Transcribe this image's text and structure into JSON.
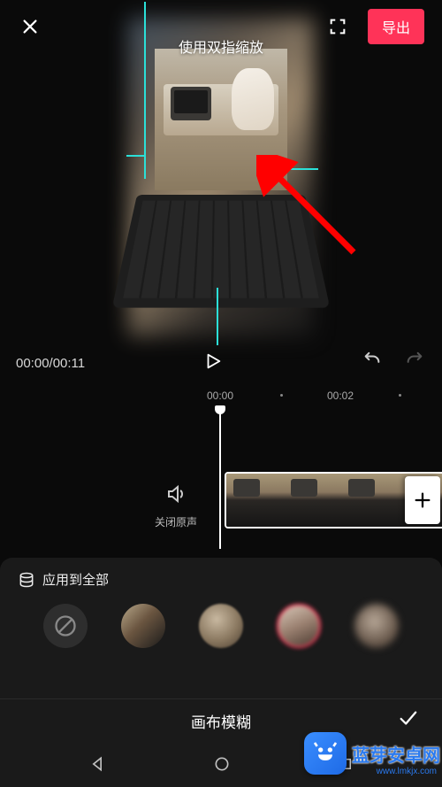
{
  "header": {
    "export_label": "导出",
    "pinch_hint": "使用双指缩放"
  },
  "playback": {
    "time_display": "00:00/00:11"
  },
  "timeline": {
    "ruler": {
      "tick1": "00:00",
      "tick2": "00:02"
    },
    "mute_label": "关闭原声"
  },
  "effects": {
    "apply_all_label": "应用到全部",
    "panel_title": "画布模糊",
    "selected_index": 3,
    "options": [
      "none",
      "blur-light",
      "blur-medium",
      "blur-strong",
      "blur-max"
    ]
  },
  "icons": {
    "close": "close-icon",
    "fullscreen": "fullscreen-icon",
    "play": "play-icon",
    "undo": "undo-icon",
    "redo": "redo-icon",
    "mute": "mute-icon",
    "add": "plus-icon",
    "apply_all": "stack-icon",
    "confirm": "check-icon",
    "nav_back": "triangle-back-icon",
    "nav_home": "circle-home-icon",
    "nav_recent": "square-recent-icon",
    "none_option": "prohibit-icon"
  },
  "watermark": {
    "text": "蓝芽安卓网",
    "sub": "www.lmkjx.com"
  },
  "colors": {
    "accent_export": "#ff3358",
    "accent_selected": "#ff3358",
    "crop_guide": "#2be0d8"
  }
}
